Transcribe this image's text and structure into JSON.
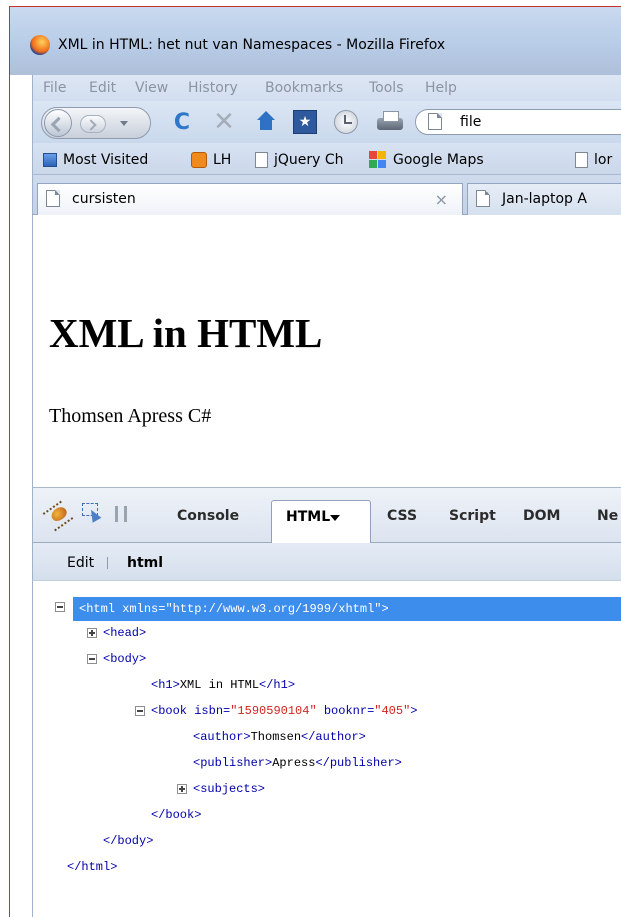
{
  "window": {
    "title": "XML in HTML: het nut van Namespaces - Mozilla Firefox"
  },
  "menu": [
    "File",
    "Edit",
    "View",
    "History",
    "Bookmarks",
    "Tools",
    "Help"
  ],
  "urlbar": {
    "value": "file"
  },
  "bookmarks": [
    {
      "label": "Most Visited",
      "icon": "most-visited-icon"
    },
    {
      "label": "LH",
      "icon": "lh-icon"
    },
    {
      "label": "jQuery Ch",
      "icon": "page-icon"
    },
    {
      "label": "Google Maps",
      "icon": "google-maps-icon"
    },
    {
      "label": "lor",
      "icon": "page-icon"
    }
  ],
  "tabs": [
    {
      "label": "cursisten",
      "close": "×"
    },
    {
      "label": "Jan-laptop A"
    }
  ],
  "page": {
    "heading": "XML in HTML",
    "text": "Thomsen Apress C#"
  },
  "firebug": {
    "tabs": [
      "Console",
      "HTML",
      "CSS",
      "Script",
      "DOM",
      "Ne"
    ],
    "active_tab": "HTML",
    "breadcrumb": {
      "edit": "Edit",
      "current": "html"
    }
  },
  "tree": {
    "html_open": "<html",
    "html_attr_name": " xmlns=",
    "html_attr_value": "\"http://www.w3.org/1999/xhtml\"",
    "html_open_end": ">",
    "head": "<head>",
    "body": "<body>",
    "h1_open": "<h1>",
    "h1_text": "XML in HTML",
    "h1_close": "</h1>",
    "book_open": "<book",
    "book_attr1": " isbn=",
    "book_val1": "\"1590590104\"",
    "book_attr2": " booknr=",
    "book_val2": "\"405\"",
    "book_open_end": ">",
    "author_open": "<author>",
    "author_text": "Thomsen",
    "author_close": "</author>",
    "publisher_open": "<publisher>",
    "publisher_text": "Apress",
    "publisher_close": "</publisher>",
    "subjects": "<subjects>",
    "book_close": "</book>",
    "body_close": "</body>",
    "html_close": "</html>"
  },
  "colors": {
    "selection": "#3d8ded",
    "tag": "#0000aa",
    "attr_value": "#d1241f"
  }
}
